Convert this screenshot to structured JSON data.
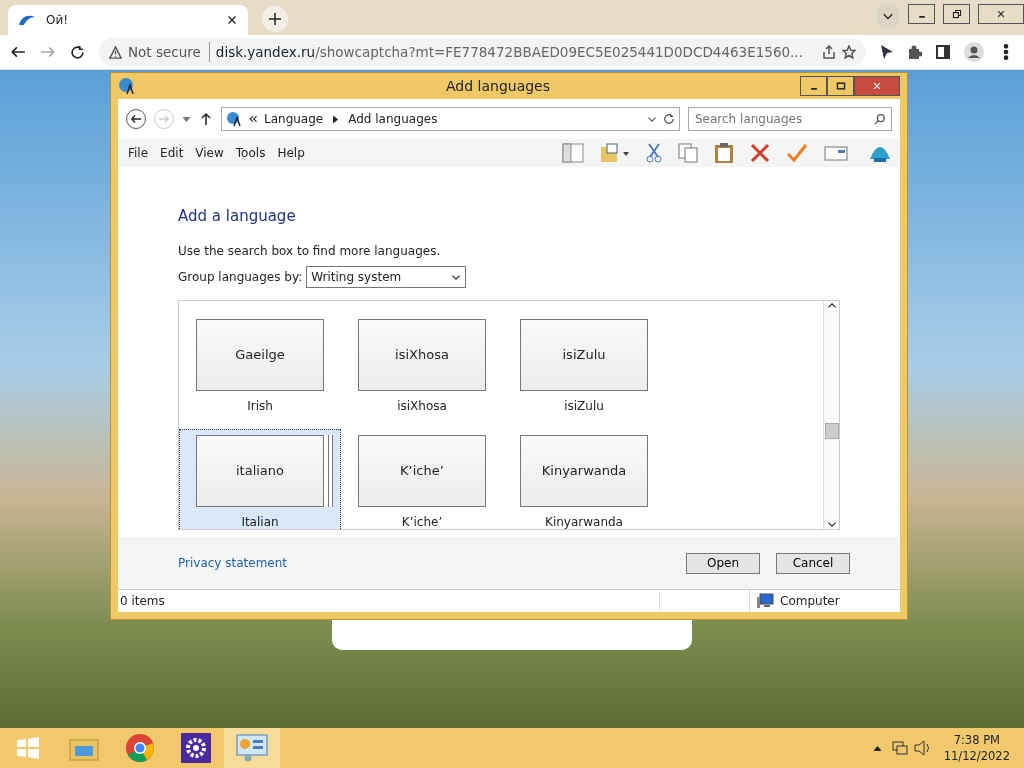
{
  "browser": {
    "tab_title": "Ой!",
    "security": "Not secure",
    "url_host": "disk.yandex.ru",
    "url_path": "/showcaptcha?mt=FE778472BBAED09EC5E025441D0DCD4463E1560..."
  },
  "dialog": {
    "title": "Add languages",
    "breadcrumb": [
      "Language",
      "Add languages"
    ],
    "search": {
      "placeholder": "Search languages"
    },
    "menu": [
      "File",
      "Edit",
      "View",
      "Tools",
      "Help"
    ],
    "heading": "Add a language",
    "hint": "Use the search box to find more languages.",
    "group_label": "Group languages by:",
    "group_value": "Writing system",
    "tiles": [
      {
        "native": "Gaeilge",
        "name": "Irish",
        "selected": false
      },
      {
        "native": "isiXhosa",
        "name": "isiXhosa",
        "selected": false
      },
      {
        "native": "isiZulu",
        "name": "isiZulu",
        "selected": false
      },
      {
        "native": "italiano",
        "name": "Italian",
        "selected": true
      },
      {
        "native": "K’iche’",
        "name": "K’iche’",
        "selected": false
      },
      {
        "native": "Kinyarwanda",
        "name": "Kinyarwanda",
        "selected": false
      }
    ],
    "privacy_link": "Privacy statement",
    "buttons": [
      "Open",
      "Cancel"
    ],
    "status_bar": {
      "items": "0 items",
      "location": "Computer"
    }
  },
  "taskbar": {
    "time": "7:38 PM",
    "date": "11/12/2022"
  }
}
